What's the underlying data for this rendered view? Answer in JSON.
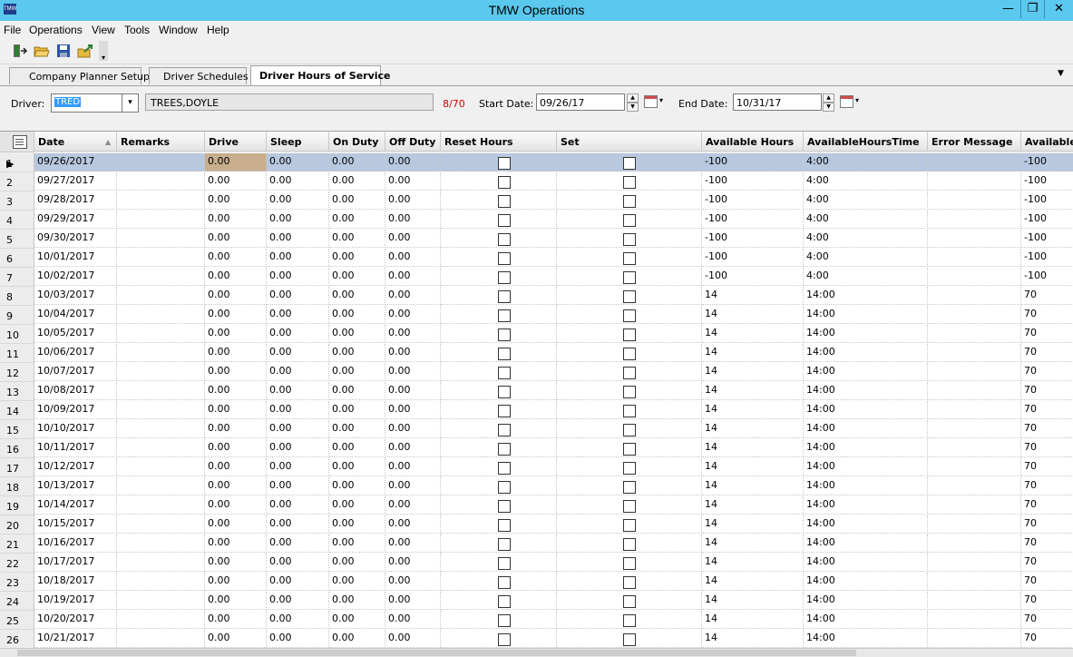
{
  "window": {
    "title": "TMW Operations",
    "app_icon_text": "TMW",
    "minimize": "—",
    "maximize": "❐",
    "close": "✕"
  },
  "menu": [
    "File",
    "Operations",
    "View",
    "Tools",
    "Window",
    "Help"
  ],
  "toolbar": {
    "icons": [
      "exit-icon",
      "open-folder-icon",
      "save-icon",
      "export-icon"
    ],
    "more": "▾"
  },
  "tabs": [
    "Company Planner Setup",
    "Driver Schedules",
    "Driver Hours of Service"
  ],
  "tabs_menu_arrow": "▼",
  "filters": {
    "driver_label": "Driver:",
    "driver_code": "TRED",
    "driver_drop": "▾",
    "driver_name": "TREES,DOYLE",
    "hours_count": "8/70",
    "start_label": "Start Date:",
    "start_date": "09/26/17",
    "end_label": "End Date:",
    "end_date": "10/31/17",
    "spin_up": "▲",
    "spin_down": "▼",
    "cal_arrow": "▾"
  },
  "grid": {
    "columns": [
      "Date",
      "Remarks",
      "Drive",
      "Sleep",
      "On Duty",
      "Off Duty",
      "Reset Hours",
      "Set",
      "Available Hours",
      "AvailableHoursTime",
      "Error Message",
      "Available"
    ],
    "sort_arrow": "▲",
    "row_pointer": "▶",
    "rows": [
      {
        "n": "1",
        "date": "09/26/2017",
        "remarks": "",
        "drive": "0.00",
        "sleep": "0.00",
        "on": "0.00",
        "off": "0.00",
        "avh": "-100",
        "avt": "4:00",
        "err": "",
        "av": "-100"
      },
      {
        "n": "2",
        "date": "09/27/2017",
        "remarks": "",
        "drive": "0.00",
        "sleep": "0.00",
        "on": "0.00",
        "off": "0.00",
        "avh": "-100",
        "avt": "4:00",
        "err": "",
        "av": "-100"
      },
      {
        "n": "3",
        "date": "09/28/2017",
        "remarks": "",
        "drive": "0.00",
        "sleep": "0.00",
        "on": "0.00",
        "off": "0.00",
        "avh": "-100",
        "avt": "4:00",
        "err": "",
        "av": "-100"
      },
      {
        "n": "4",
        "date": "09/29/2017",
        "remarks": "",
        "drive": "0.00",
        "sleep": "0.00",
        "on": "0.00",
        "off": "0.00",
        "avh": "-100",
        "avt": "4:00",
        "err": "",
        "av": "-100"
      },
      {
        "n": "5",
        "date": "09/30/2017",
        "remarks": "",
        "drive": "0.00",
        "sleep": "0.00",
        "on": "0.00",
        "off": "0.00",
        "avh": "-100",
        "avt": "4:00",
        "err": "",
        "av": "-100"
      },
      {
        "n": "6",
        "date": "10/01/2017",
        "remarks": "",
        "drive": "0.00",
        "sleep": "0.00",
        "on": "0.00",
        "off": "0.00",
        "avh": "-100",
        "avt": "4:00",
        "err": "",
        "av": "-100"
      },
      {
        "n": "7",
        "date": "10/02/2017",
        "remarks": "",
        "drive": "0.00",
        "sleep": "0.00",
        "on": "0.00",
        "off": "0.00",
        "avh": "-100",
        "avt": "4:00",
        "err": "",
        "av": "-100"
      },
      {
        "n": "8",
        "date": "10/03/2017",
        "remarks": "",
        "drive": "0.00",
        "sleep": "0.00",
        "on": "0.00",
        "off": "0.00",
        "avh": "14",
        "avt": "14:00",
        "err": "",
        "av": "70"
      },
      {
        "n": "9",
        "date": "10/04/2017",
        "remarks": "",
        "drive": "0.00",
        "sleep": "0.00",
        "on": "0.00",
        "off": "0.00",
        "avh": "14",
        "avt": "14:00",
        "err": "",
        "av": "70"
      },
      {
        "n": "10",
        "date": "10/05/2017",
        "remarks": "",
        "drive": "0.00",
        "sleep": "0.00",
        "on": "0.00",
        "off": "0.00",
        "avh": "14",
        "avt": "14:00",
        "err": "",
        "av": "70"
      },
      {
        "n": "11",
        "date": "10/06/2017",
        "remarks": "",
        "drive": "0.00",
        "sleep": "0.00",
        "on": "0.00",
        "off": "0.00",
        "avh": "14",
        "avt": "14:00",
        "err": "",
        "av": "70"
      },
      {
        "n": "12",
        "date": "10/07/2017",
        "remarks": "",
        "drive": "0.00",
        "sleep": "0.00",
        "on": "0.00",
        "off": "0.00",
        "avh": "14",
        "avt": "14:00",
        "err": "",
        "av": "70"
      },
      {
        "n": "13",
        "date": "10/08/2017",
        "remarks": "",
        "drive": "0.00",
        "sleep": "0.00",
        "on": "0.00",
        "off": "0.00",
        "avh": "14",
        "avt": "14:00",
        "err": "",
        "av": "70"
      },
      {
        "n": "14",
        "date": "10/09/2017",
        "remarks": "",
        "drive": "0.00",
        "sleep": "0.00",
        "on": "0.00",
        "off": "0.00",
        "avh": "14",
        "avt": "14:00",
        "err": "",
        "av": "70"
      },
      {
        "n": "15",
        "date": "10/10/2017",
        "remarks": "",
        "drive": "0.00",
        "sleep": "0.00",
        "on": "0.00",
        "off": "0.00",
        "avh": "14",
        "avt": "14:00",
        "err": "",
        "av": "70"
      },
      {
        "n": "16",
        "date": "10/11/2017",
        "remarks": "",
        "drive": "0.00",
        "sleep": "0.00",
        "on": "0.00",
        "off": "0.00",
        "avh": "14",
        "avt": "14:00",
        "err": "",
        "av": "70"
      },
      {
        "n": "17",
        "date": "10/12/2017",
        "remarks": "",
        "drive": "0.00",
        "sleep": "0.00",
        "on": "0.00",
        "off": "0.00",
        "avh": "14",
        "avt": "14:00",
        "err": "",
        "av": "70"
      },
      {
        "n": "18",
        "date": "10/13/2017",
        "remarks": "",
        "drive": "0.00",
        "sleep": "0.00",
        "on": "0.00",
        "off": "0.00",
        "avh": "14",
        "avt": "14:00",
        "err": "",
        "av": "70"
      },
      {
        "n": "19",
        "date": "10/14/2017",
        "remarks": "",
        "drive": "0.00",
        "sleep": "0.00",
        "on": "0.00",
        "off": "0.00",
        "avh": "14",
        "avt": "14:00",
        "err": "",
        "av": "70"
      },
      {
        "n": "20",
        "date": "10/15/2017",
        "remarks": "",
        "drive": "0.00",
        "sleep": "0.00",
        "on": "0.00",
        "off": "0.00",
        "avh": "14",
        "avt": "14:00",
        "err": "",
        "av": "70"
      },
      {
        "n": "21",
        "date": "10/16/2017",
        "remarks": "",
        "drive": "0.00",
        "sleep": "0.00",
        "on": "0.00",
        "off": "0.00",
        "avh": "14",
        "avt": "14:00",
        "err": "",
        "av": "70"
      },
      {
        "n": "22",
        "date": "10/17/2017",
        "remarks": "",
        "drive": "0.00",
        "sleep": "0.00",
        "on": "0.00",
        "off": "0.00",
        "avh": "14",
        "avt": "14:00",
        "err": "",
        "av": "70"
      },
      {
        "n": "23",
        "date": "10/18/2017",
        "remarks": "",
        "drive": "0.00",
        "sleep": "0.00",
        "on": "0.00",
        "off": "0.00",
        "avh": "14",
        "avt": "14:00",
        "err": "",
        "av": "70"
      },
      {
        "n": "24",
        "date": "10/19/2017",
        "remarks": "",
        "drive": "0.00",
        "sleep": "0.00",
        "on": "0.00",
        "off": "0.00",
        "avh": "14",
        "avt": "14:00",
        "err": "",
        "av": "70"
      },
      {
        "n": "25",
        "date": "10/20/2017",
        "remarks": "",
        "drive": "0.00",
        "sleep": "0.00",
        "on": "0.00",
        "off": "0.00",
        "avh": "14",
        "avt": "14:00",
        "err": "",
        "av": "70"
      },
      {
        "n": "26",
        "date": "10/21/2017",
        "remarks": "",
        "drive": "0.00",
        "sleep": "0.00",
        "on": "0.00",
        "off": "0.00",
        "avh": "14",
        "avt": "14:00",
        "err": "",
        "av": "70"
      }
    ]
  }
}
